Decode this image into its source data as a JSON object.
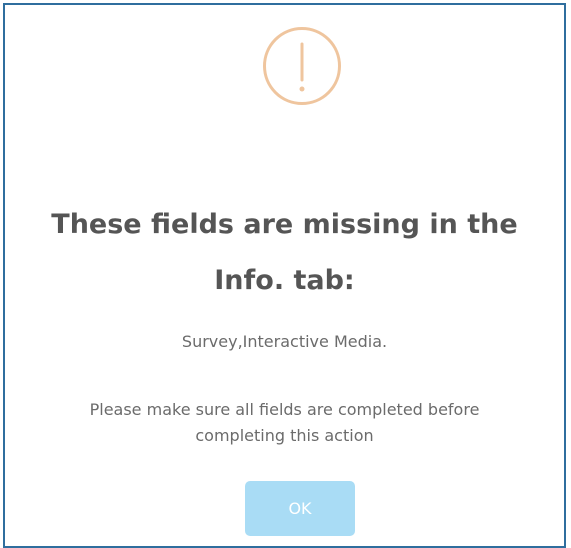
{
  "dialog": {
    "icon": "exclamation-circle-icon",
    "title_line1": "These fields are missing in the",
    "title_line2": "Info. tab:",
    "missing_fields": "Survey,Interactive Media.",
    "message_line1": "Please make sure all fields are completed before",
    "message_line2": "completing this action",
    "ok_label": "OK"
  },
  "colors": {
    "border": "#2f6e9e",
    "icon": "#efc59e",
    "button": "#a9dcf5",
    "text": "#6b6b6b",
    "title": "#555555"
  }
}
